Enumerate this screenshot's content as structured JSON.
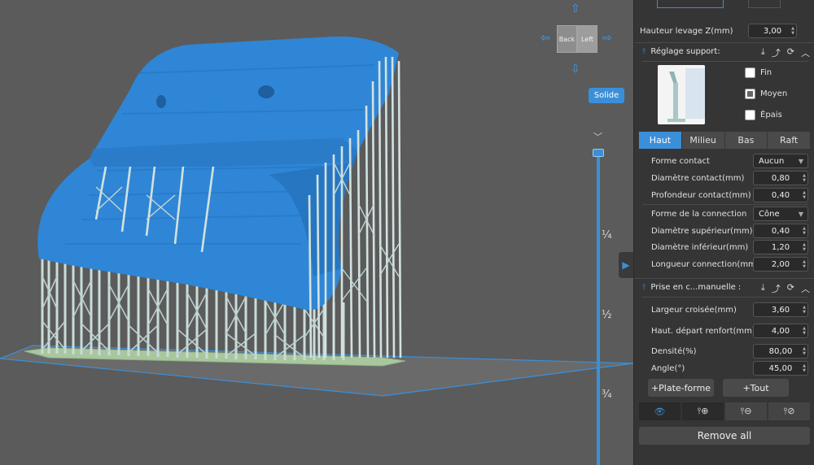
{
  "viewport": {
    "view_cube": {
      "back": "Back",
      "left": "Left"
    },
    "solid_button": "Solide",
    "slider_ticks": [
      "¼",
      "½",
      "¾"
    ]
  },
  "panel": {
    "lift_height": {
      "label": "Hauteur levage Z(mm)",
      "value": "3,00"
    },
    "support_section": {
      "title": "Réglage support:",
      "icon": "support-icon"
    },
    "density_options": [
      {
        "label": "Fin",
        "checked": false
      },
      {
        "label": "Moyen",
        "checked": true
      },
      {
        "label": "Épais",
        "checked": false
      }
    ],
    "tabs": [
      {
        "label": "Haut",
        "active": true
      },
      {
        "label": "Milieu",
        "active": false
      },
      {
        "label": "Bas",
        "active": false
      },
      {
        "label": "Raft",
        "active": false
      }
    ],
    "top_settings": [
      {
        "label": "Forme contact",
        "value": "Aucun",
        "type": "select"
      },
      {
        "label": "Diamètre contact(mm)",
        "value": "0,80",
        "type": "number"
      },
      {
        "label": "Profondeur contact(mm)",
        "value": "0,40",
        "type": "number"
      },
      {
        "label": "Forme de la connection",
        "value": "Cône",
        "type": "select"
      },
      {
        "label": "Diamètre supérieur(mm)",
        "value": "0,40",
        "type": "number"
      },
      {
        "label": "Diamètre inférieur(mm)",
        "value": "1,20",
        "type": "number"
      },
      {
        "label": "Longueur connection(mm)",
        "value": "2,00",
        "type": "number"
      }
    ],
    "manual_section": {
      "title": "Prise en c...manuelle :"
    },
    "manual_settings": [
      {
        "label": "Largeur croisée(mm)",
        "value": "3,60"
      },
      {
        "label": "Haut. départ renfort(mm)",
        "value": "4,00"
      },
      {
        "label": "Densité(%)",
        "value": "80,00"
      },
      {
        "label": "Angle(°)",
        "value": "45,00"
      }
    ],
    "add_platform_button": "+Plate-forme",
    "add_all_button": "+Tout",
    "remove_all_button": "Remove all"
  },
  "colors": {
    "accent": "#3b8fd9",
    "model": "#2f86d6",
    "supports": "#c5d8d6",
    "background": "#5b5b5b",
    "panel": "#353535"
  }
}
